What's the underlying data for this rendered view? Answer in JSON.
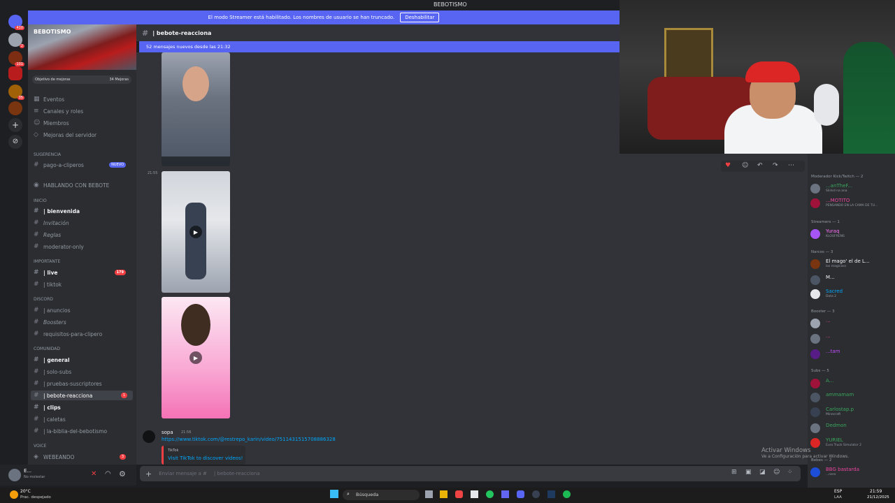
{
  "window": {
    "title": "BEBOTISMO"
  },
  "streamer_banner": {
    "text": "El modo Streamer está habilitado. Los nombres de usuario se han truncado.",
    "button": "Deshabilitar"
  },
  "servers": {
    "badges": [
      "410",
      "2",
      "101",
      "35"
    ]
  },
  "sidebar": {
    "server_name": "BEBOTISMO",
    "boost_goal": {
      "label": "Objetivo de mejoras",
      "count": "34 Mejoras"
    },
    "top_items": [
      "Eventos",
      "Canales y roles",
      "Miembros",
      "Mejoras del servidor"
    ],
    "suggestion_label": "Sugerencia",
    "suggestion_channel": "pago-a-cliperos",
    "new_tag": "NUEVO",
    "hablando": "HABLANDO CON BEBOTE",
    "categories": {
      "inicio": "INICIO",
      "importante": "IMPORTANTE",
      "discord": "DISCORD",
      "comunidad": "COMUNIDAD",
      "voice": "VOICE"
    },
    "channels": {
      "bienvenida": "| bienvenida",
      "invitacion": "Invitación",
      "reglas": "Reglas",
      "moderator": "moderator-only",
      "live": "| live",
      "live_count": "179",
      "tiktok": "| tiktok",
      "anuncios": "| anuncios",
      "boosters": "Boosters",
      "requisitos": "requisitos-para-clipero",
      "general": "| general",
      "solo_subs": "| solo-subs",
      "pruebas": "| pruebas-suscriptores",
      "bebote": "| bebote-reacciona",
      "bebote_count": "1",
      "clips": "| clips",
      "caletas": "| caletas",
      "biblia": "| la-biblia-del-bebotismo",
      "webeando": "WEBEANDO",
      "webeando_count": "3"
    }
  },
  "user_panel": {
    "name": "E...",
    "status": "No molestar"
  },
  "channel_header": {
    "name": "| bebote-reacciona"
  },
  "new_messages": "52 mensajes nuevos desde las 21:32",
  "chat": {
    "timestamp1": "21:55",
    "message": {
      "author": "sopa",
      "time": "21:56",
      "link": "https://www.tiktok.com/@restrepo_karin/video/7511431515708886328",
      "embed_provider": "TikTok",
      "embed_title": "Visit TikTok to discover videos!"
    },
    "composer_placeholder": "Enviar mensaje a #",
    "composer_channel": "| bebote-reacciona"
  },
  "members": {
    "categories": {
      "mod": "Moderador Kick/Twitch — 2",
      "streamers": "Streamers — 1",
      "narcos": "Narcos — 3",
      "booster": "Booster — 3",
      "subs": "Subs — 5",
      "bebes": "Bebes — 2"
    },
    "rows": [
      {
        "name": "...anTheF...",
        "status": "Slinkd na ana",
        "color": "#3ba55d"
      },
      {
        "name": "...MOTITO",
        "status": "PENSANDO EN LA CAMA DE TU...",
        "color": "#eb459e"
      },
      {
        "name": "Yuraq",
        "status": "KLOUFRENS",
        "color": "#ff73fa"
      },
      {
        "name": "El mago' el de L...",
        "status": "los magicass",
        "color": "#f2f3f5"
      },
      {
        "name": "M...",
        "status": "",
        "color": "#f2f3f5"
      },
      {
        "name": "Sacred",
        "status": "Dota 2",
        "color": "#00a8fc"
      },
      {
        "name": "...",
        "status": "",
        "color": "#eb459e"
      },
      {
        "name": "...",
        "status": "",
        "color": "#eb459e"
      },
      {
        "name": "...tam",
        "status": "",
        "color": "#c04cff"
      },
      {
        "name": "A...",
        "status": "",
        "color": "#3ba55d"
      },
      {
        "name": "ammamam",
        "status": "",
        "color": "#3ba55d"
      },
      {
        "name": "Carlostap.p",
        "status": "Minecraft",
        "color": "#3ba55d"
      },
      {
        "name": "Dedmon",
        "status": "",
        "color": "#3ba55d"
      },
      {
        "name": "YURIEL",
        "status": "Euro Truck Simulator 2",
        "color": "#3ba55d"
      },
      {
        "name": "BBG bastarda",
        "status": "...nero",
        "color": "#eb459e"
      }
    ]
  },
  "activate_windows": {
    "title": "Activar Windows",
    "sub": "Ve a Configuración para activar Windows."
  },
  "taskbar": {
    "weather_temp": "20°C",
    "weather_desc": "Prac. despejado",
    "search": "Búsqueda",
    "lang": "ESP",
    "lang2": "LAA",
    "time": "21:59",
    "date": "21/12/2025"
  }
}
